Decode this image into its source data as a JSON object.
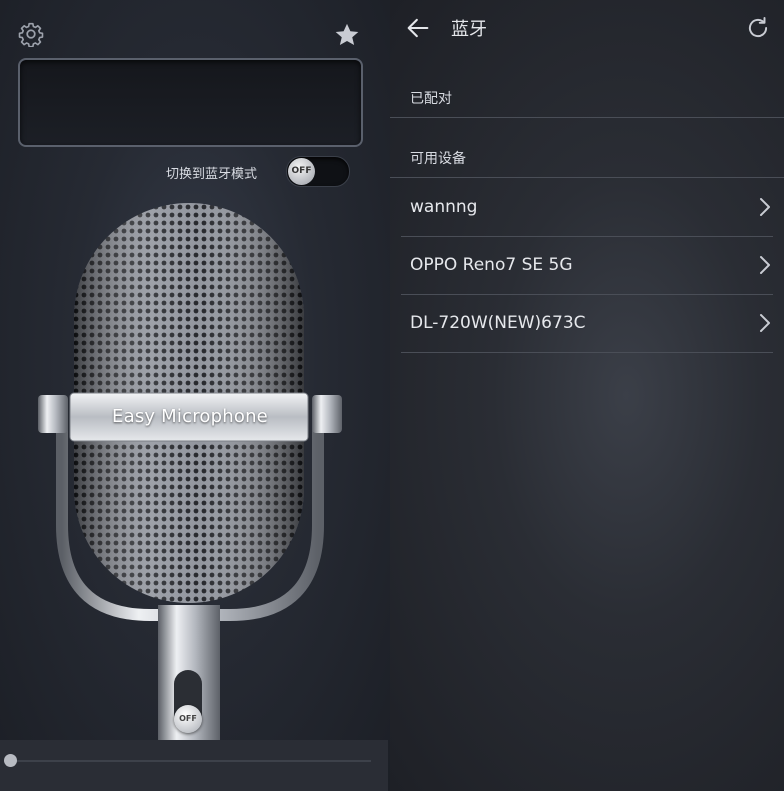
{
  "left_panel": {
    "bluetooth_mode_label": "切换到蓝牙模式",
    "toggle_state": "OFF",
    "mic_brand": "Easy Microphone",
    "mic_switch_state": "OFF",
    "volume_level": 0.0
  },
  "right_panel": {
    "title": "蓝牙",
    "paired_section": "已配对",
    "available_section": "可用设备",
    "devices": [
      {
        "name": "wannng"
      },
      {
        "name": "OPPO Reno7 SE 5G"
      },
      {
        "name": "DL-720W(NEW)673C"
      }
    ]
  },
  "icons": {
    "settings": "gear-icon",
    "favorite": "star-icon",
    "back": "back-arrow-icon",
    "refresh": "refresh-icon",
    "chevron": "chevron-right-icon"
  }
}
